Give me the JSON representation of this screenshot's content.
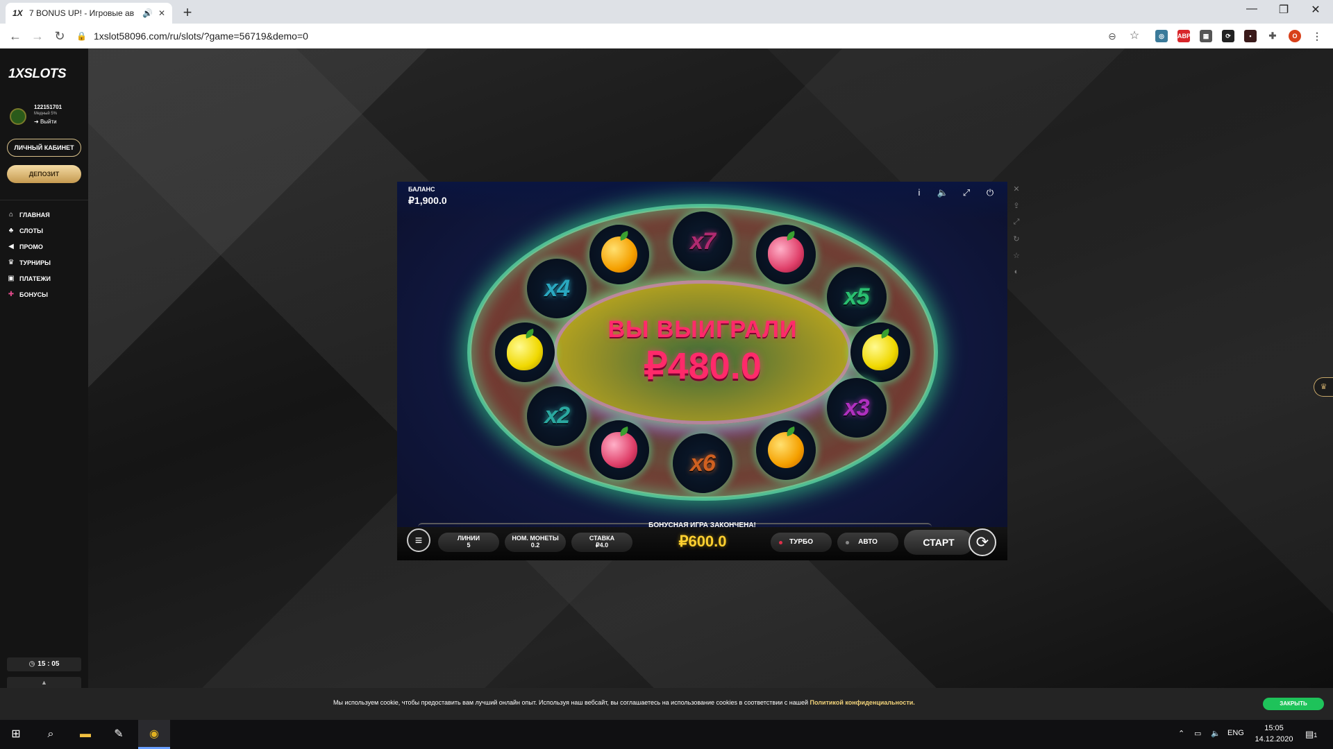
{
  "browser": {
    "tab_title": "7 BONUS UP! - Игровые ав",
    "tab_favicon": "1X",
    "url": "1xslot58096.com/ru/slots/?game=56719&demo=0",
    "profile_initial": "O",
    "ext_abp": "ABP"
  },
  "site": {
    "logo": "1XSLOTS",
    "user_id": "122151701",
    "user_status": "Медный 5%",
    "logout": "Выйти",
    "cabinet_button": "ЛИЧНЫЙ КАБИНЕТ",
    "deposit_button": "ДЕПОЗИТ",
    "nav": [
      {
        "label": "ГЛАВНАЯ",
        "icon": "home-icon"
      },
      {
        "label": "СЛОТЫ",
        "icon": "slots-icon"
      },
      {
        "label": "ПРОМО",
        "icon": "megaphone-icon"
      },
      {
        "label": "ТУРНИРЫ",
        "icon": "trophy-icon"
      },
      {
        "label": "ПЛАТЕЖИ",
        "icon": "wallet-icon"
      },
      {
        "label": "БОНУСЫ",
        "icon": "gift-icon"
      }
    ],
    "clock": "15 : 05"
  },
  "game": {
    "balance_label": "БАЛАНС",
    "balance_value": "₽1,900.0",
    "win_title": "ВЫ ВЫИГРАЛИ",
    "win_amount": "₽480.0",
    "cells": [
      {
        "kind": "mult",
        "text": "x4",
        "color": "#2aa8c0"
      },
      {
        "kind": "fruit",
        "fruit": "orange"
      },
      {
        "kind": "mult",
        "text": "x7",
        "color": "#b02a70"
      },
      {
        "kind": "fruit",
        "fruit": "berry"
      },
      {
        "kind": "mult",
        "text": "x5",
        "color": "#2ac070"
      },
      {
        "kind": "fruit",
        "fruit": "lemon"
      },
      {
        "kind": "fruit",
        "fruit": "lemon"
      },
      {
        "kind": "mult",
        "text": "x3",
        "color": "#b030c0"
      },
      {
        "kind": "mult",
        "text": "x2",
        "color": "#2aa8a0"
      },
      {
        "kind": "fruit",
        "fruit": "berry"
      },
      {
        "kind": "mult",
        "text": "x6",
        "color": "#d06020"
      },
      {
        "kind": "fruit",
        "fruit": "orange"
      }
    ],
    "bonus_message": "БОНУСНАЯ ИГРА ЗАКОНЧЕНА!",
    "lines_label": "ЛИНИИ",
    "lines_value": "5",
    "coin_label": "НОМ. МОНЕТЫ",
    "coin_value": "0.2",
    "bet_label": "СТАВКА",
    "bet_value": "₽4.0",
    "total_win": "₽600.0",
    "turbo_label": "ТУРБО",
    "auto_label": "АВТО",
    "start_label": "СТАРТ",
    "accent_win": "#ff2a6a",
    "accent_total": "#ffd030"
  },
  "cookie": {
    "text": "Мы используем cookie, чтобы предоставить вам лучший онлайн опыт. Используя наш вебсайт, вы соглашаетесь на использование cookies в соответствии с нашей",
    "link": "Политикой конфиденциальности.",
    "button": "ЗАКРЫТЬ"
  },
  "taskbar": {
    "language": "ENG",
    "time": "15:05",
    "date": "14.12.2020",
    "notifications": "1"
  }
}
